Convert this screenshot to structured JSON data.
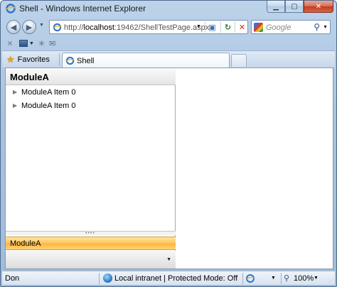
{
  "window": {
    "title": "Shell - Windows Internet Explorer",
    "caption_buttons": {
      "minimize": "▁",
      "maximize": "▢",
      "close": "✕"
    }
  },
  "navigation": {
    "back_icon": "back-arrow-icon",
    "forward_icon": "forward-arrow-icon",
    "url_prefix": "http://",
    "url_host": "localhost",
    "url_rest": ":19462/ShellTestPage.aspx",
    "search_placeholder": "Google"
  },
  "favorites": {
    "label": "Favorites"
  },
  "tabs": [
    {
      "label": "Shell",
      "active": true
    }
  ],
  "panel": {
    "header": "ModuleA",
    "items": [
      {
        "label": "ModuleA Item 0"
      },
      {
        "label": "ModuleA Item 0"
      }
    ],
    "module_bar": "ModuleA"
  },
  "status": {
    "text": "Don",
    "zone": "Local intranet | Protected Mode: Off",
    "zoom": "100%"
  },
  "colors": {
    "module_bar_accent": "#ffc45a",
    "chrome_blue": "#a9c3df"
  }
}
